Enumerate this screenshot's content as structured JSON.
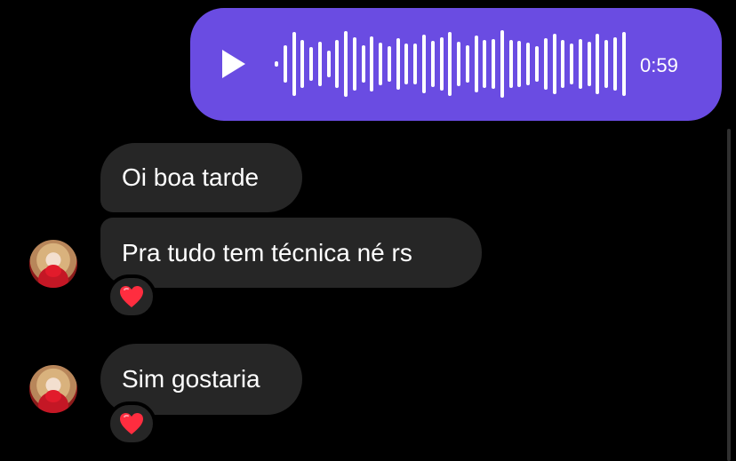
{
  "voice_message": {
    "duration": "0:59",
    "accent": "#6a4ce2",
    "waveform_levels": [
      0.08,
      0.55,
      0.92,
      0.68,
      0.48,
      0.64,
      0.38,
      0.7,
      0.95,
      0.76,
      0.55,
      0.8,
      0.62,
      0.51,
      0.74,
      0.58,
      0.6,
      0.85,
      0.66,
      0.76,
      0.93,
      0.63,
      0.55,
      0.82,
      0.68,
      0.71,
      0.98,
      0.7,
      0.66,
      0.62,
      0.52,
      0.74,
      0.86,
      0.69,
      0.58,
      0.72,
      0.64,
      0.86,
      0.68,
      0.77,
      0.92
    ]
  },
  "messages": [
    {
      "text": "Oi boa tarde"
    },
    {
      "text": "Pra tudo tem técnica né rs",
      "reaction": "❤️"
    },
    {
      "text": "Sim gostaria",
      "reaction": "❤️"
    }
  ]
}
